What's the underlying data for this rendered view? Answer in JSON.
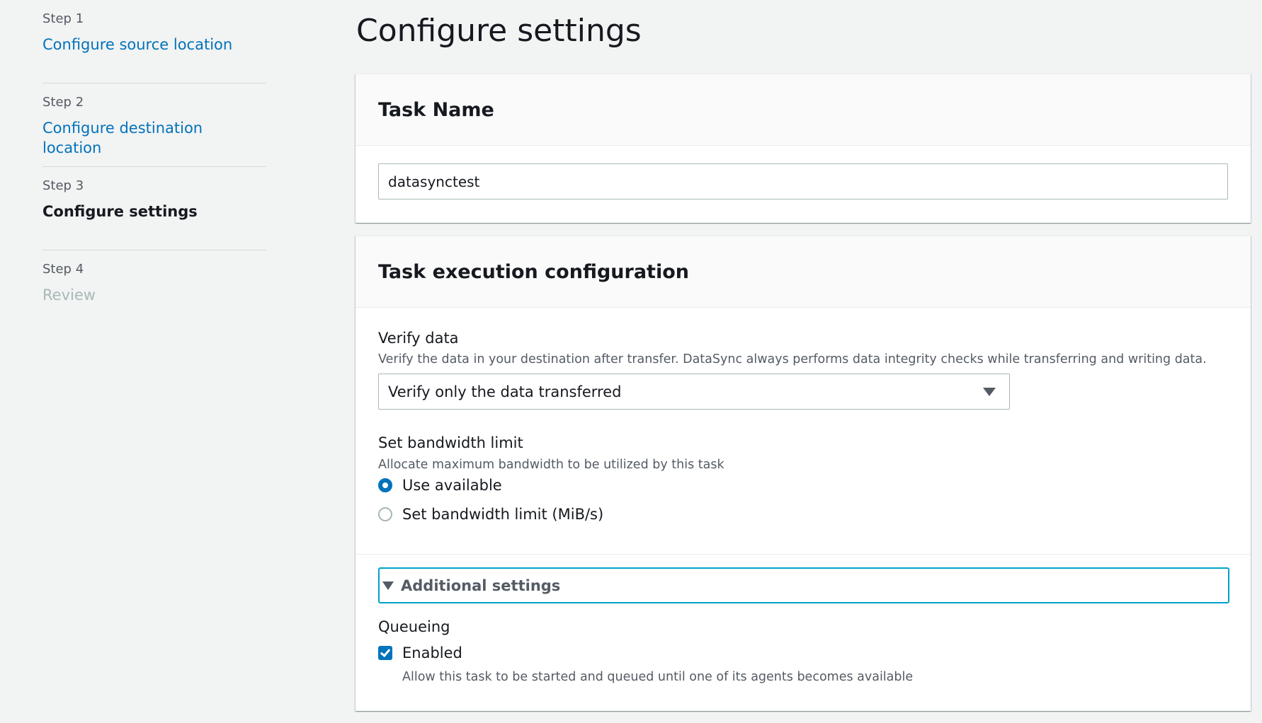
{
  "wizard": {
    "steps": [
      {
        "number": "Step 1",
        "title": "Configure source location"
      },
      {
        "number": "Step 2",
        "title": "Configure destination location"
      },
      {
        "number": "Step 3",
        "title": "Configure settings"
      },
      {
        "number": "Step 4",
        "title": "Review"
      }
    ]
  },
  "page": {
    "title": "Configure settings"
  },
  "task_name": {
    "header": "Task Name",
    "value": "datasynctest"
  },
  "execution": {
    "header": "Task execution configuration",
    "verify": {
      "label": "Verify data",
      "description": "Verify the data in your destination after transfer. DataSync always performs data integrity checks while transferring and writing data.",
      "selected": "Verify only the data transferred"
    },
    "bandwidth": {
      "label": "Set bandwidth limit",
      "description": "Allocate maximum bandwidth to be utilized by this task",
      "options": [
        {
          "label": "Use available",
          "checked": true
        },
        {
          "label": "Set bandwidth limit (MiB/s)",
          "checked": false
        }
      ]
    },
    "additional": {
      "label": "Additional settings",
      "queueing": {
        "label": "Queueing",
        "checkbox_label": "Enabled",
        "checked": true,
        "description": "Allow this task to be started and queued until one of its agents becomes available"
      }
    }
  },
  "colors": {
    "link": "#0073bb",
    "accent_focus": "#00a1c9",
    "disabled": "#aab7b8",
    "background": "#f2f3f3"
  }
}
